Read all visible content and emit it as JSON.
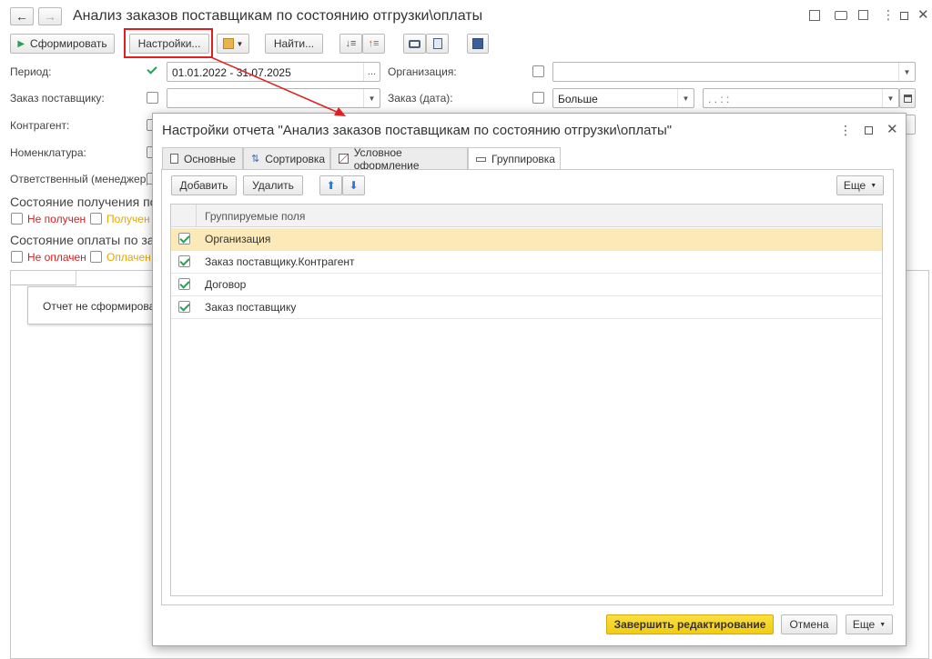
{
  "window": {
    "title": "Анализ заказов поставщикам по состоянию отгрузки\\оплаты",
    "nav_back": "←",
    "nav_forward": "→"
  },
  "toolbar": {
    "form_button": "Сформировать",
    "settings_button": "Настройки...",
    "find_button": "Найти...",
    "more_button_label": ""
  },
  "filters": {
    "period_label": "Период:",
    "period_value": "01.01.2022 - 31.07.2025",
    "period_btn": "...",
    "org_label": "Организация:",
    "order_label": "Заказ поставщику:",
    "order_date_label": "Заказ (дата):",
    "order_date_cond": "Больше",
    "order_date_value": " .  .     :  :",
    "counterparty_label": "Контрагент:",
    "nomenclature_label": "Номенклатура:",
    "responsible_label": "Ответственный (менеджер):",
    "receipt_state_label": "Состояние получения по",
    "not_received": "Не получен",
    "received": "Получен",
    "payment_state_label": "Состояние оплаты по зак",
    "not_paid": "Не оплачен",
    "paid": "Оплачен"
  },
  "report_area": {
    "not_formed": "Отчет не сформирован."
  },
  "dialog": {
    "title": "Настройки отчета \"Анализ заказов поставщикам по состоянию отгрузки\\оплаты\"",
    "tabs": [
      {
        "label": "Основные"
      },
      {
        "label": "Сортировка"
      },
      {
        "label": "Условное оформление"
      },
      {
        "label": "Группировка"
      }
    ],
    "add_button": "Добавить",
    "delete_button": "Удалить",
    "more_button": "Еще",
    "table_header": "Группируемые поля",
    "rows": [
      {
        "label": "Организация",
        "checked": true
      },
      {
        "label": "Заказ поставщику.Контрагент",
        "checked": true
      },
      {
        "label": "Договор",
        "checked": true
      },
      {
        "label": "Заказ поставщику",
        "checked": true
      }
    ],
    "finish_button": "Завершить редактирование",
    "cancel_button": "Отмена",
    "footer_more_button": "Еще"
  },
  "colors": {
    "highlight_red": "#e02020",
    "selected_row": "#fbe9b8",
    "finish_yellow": "#f7d51c",
    "checkbox_green": "#2aa055"
  }
}
